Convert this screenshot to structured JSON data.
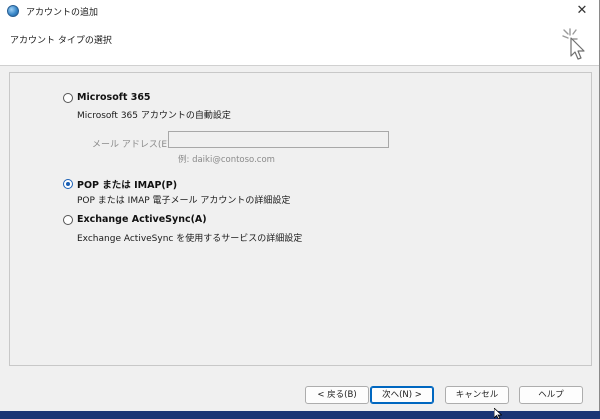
{
  "window": {
    "title": "アカウントの追加",
    "close_symbol": "✕"
  },
  "header": {
    "title": "アカウント タイプの選択",
    "icon": "cursor-click-icon"
  },
  "options": [
    {
      "label": "Microsoft 365",
      "description": "Microsoft 365 アカウントの自動設定",
      "checked": false
    },
    {
      "label": "POP または IMAP(P)",
      "description": "POP または IMAP 電子メール アカウントの詳細設定",
      "checked": true
    },
    {
      "label": "Exchange ActiveSync(A)",
      "description": "Exchange ActiveSync を使用するサービスの詳細設定",
      "checked": false
    }
  ],
  "email": {
    "label": "メール アドレス(E):",
    "value": "",
    "example": "例: daiki@contoso.com"
  },
  "footer": {
    "back_label": "< 戻る(B)",
    "next_label": "次へ(N) >",
    "cancel_label": "キャンセル",
    "help_label": "ヘルプ"
  },
  "colors": {
    "accent": "#0067c0",
    "desktop": "#1e3a78"
  }
}
